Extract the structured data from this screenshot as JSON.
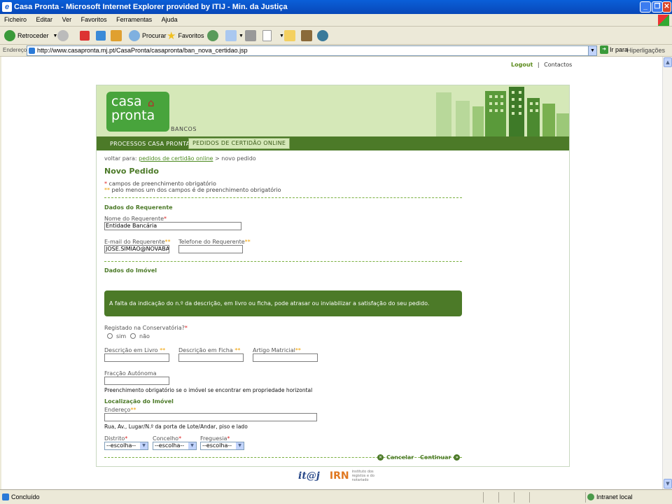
{
  "window": {
    "title": "Casa Pronta - Microsoft Internet Explorer provided by ITIJ - Min. da Justiça"
  },
  "menu": [
    "Ficheiro",
    "Editar",
    "Ver",
    "Favoritos",
    "Ferramentas",
    "Ajuda"
  ],
  "toolbar": {
    "back": "Retroceder",
    "search": "Procurar",
    "favorites": "Favoritos"
  },
  "address": {
    "label": "Endereço",
    "url": "http://www.casapronta.mj.pt/CasaPronta/casapronta/ban_nova_certidao.jsp",
    "go": "Ir para",
    "links": "Hiperligações"
  },
  "status": {
    "left": "Concluído",
    "zone": "Intranet local"
  },
  "page": {
    "logout": "Logout",
    "sep": "|",
    "contacts": "Contactos",
    "logo_line1": "casa",
    "logo_line2": "pronta",
    "bancos": "BANCOS",
    "tab_processos": "PROCESSOS CASA PRONTA",
    "tab_pedidos": "PEDIDOS DE CERTIDÃO ONLINE",
    "crumb_prefix": "voltar para: ",
    "crumb_link": "pedidos de certidão online",
    "crumb_suffix": " > novo pedido",
    "title": "Novo Pedido",
    "required_mark": "*",
    "required_note": " campos de preenchimento obrigatório",
    "optional_mark": "**",
    "optional_note": " pelo menos um dos campos é de preenchimento obrigatório",
    "section_requerente": "Dados do Requerente",
    "nome_label": "Nome do Requerente",
    "nome_value": "Entidade Bancária",
    "email_label": "E-mail do Requerente",
    "email_value": "JOSE.SIMIAO@NOVABA",
    "telefone_label": "Telefone do Requerente",
    "telefone_value": "",
    "section_imovel": "Dados do Imóvel",
    "warning": "A falta da indicação do n.º da descrição, em livro ou ficha, pode atrasar ou inviabilizar a satisfação do seu pedido.",
    "registado_label": "Registado na Conservatória?",
    "sim": "sim",
    "nao": "não",
    "livro_label": "Descrição em Livro ",
    "ficha_label": "Descrição em Ficha ",
    "artigo_label": "Artigo Matricial",
    "fraccao_label": "Fracção Autónoma",
    "fraccao_hint": "Preenchimento obrigatório se o imóvel se encontrar em propriedade horizontal",
    "localizacao": "Localização do Imóvel",
    "endereco_label": "Endereço",
    "endereco_hint": "Rua, Av., Lugar/N.º da porta de Lote/Andar, piso e lado",
    "distrito_label": "Distrito",
    "concelho_label": "Concelho",
    "freguesia_label": "Freguesia",
    "select_value": "--escolha--",
    "cancel": "Cancelar",
    "continue": "Continuar",
    "footer_itij": "it@j",
    "footer_irn": "IRN",
    "footer_irn_text": "instituto dos registos e do notariado"
  }
}
